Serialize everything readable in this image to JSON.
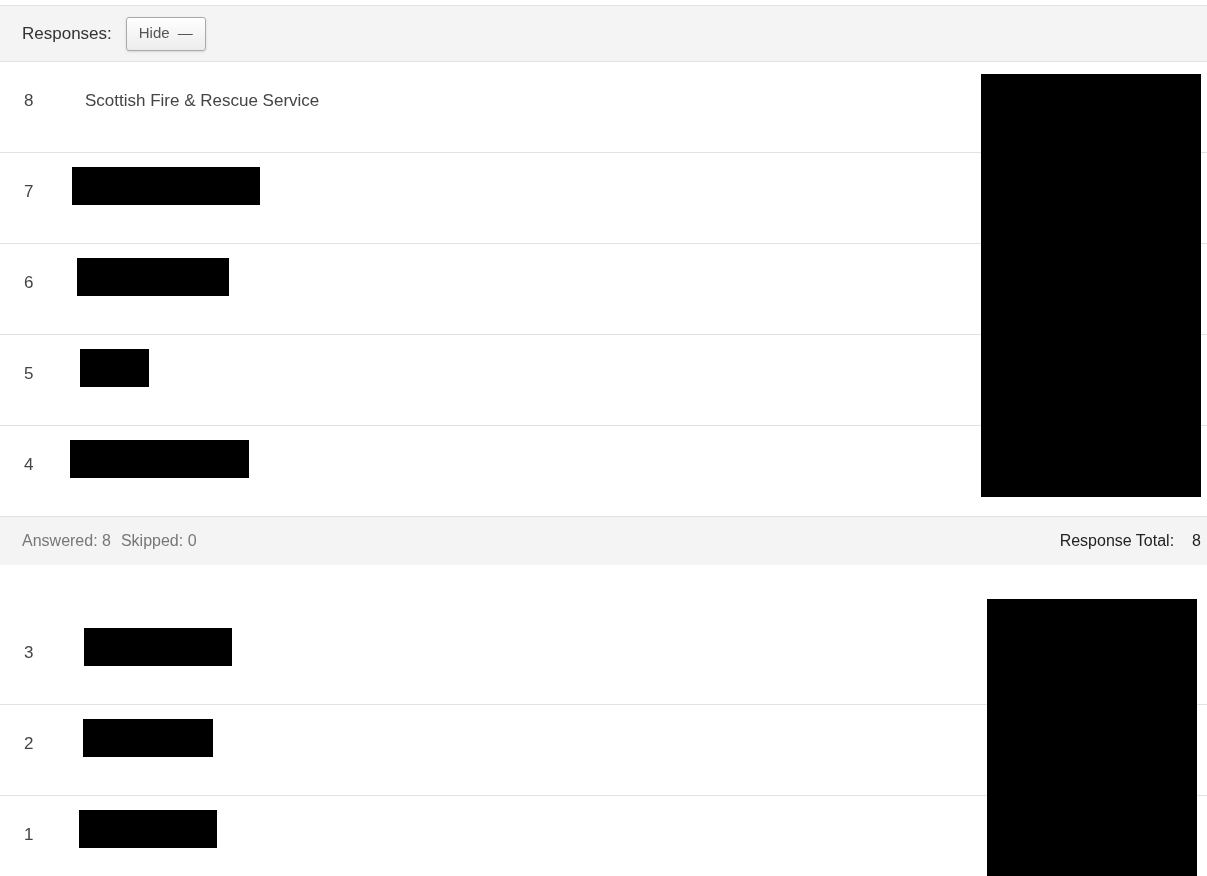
{
  "header": {
    "label": "Responses:",
    "button": "Hide",
    "button_icon": "—"
  },
  "groups": [
    {
      "side_redacted": true,
      "rows": [
        {
          "number": "8",
          "answer": "Scottish Fire & Rescue Service",
          "redacted": false
        },
        {
          "number": "7",
          "redacted": true
        },
        {
          "number": "6",
          "redacted": true
        },
        {
          "number": "5",
          "redacted": true
        },
        {
          "number": "4",
          "redacted": true
        }
      ]
    },
    {
      "side_redacted": true,
      "rows": [
        {
          "number": "3",
          "redacted": true
        },
        {
          "number": "2",
          "redacted": true
        },
        {
          "number": "1",
          "redacted": true
        }
      ]
    }
  ],
  "summary": {
    "answered": "Answered: 8",
    "skipped": "Skipped: 0",
    "total_label": "Response Total:",
    "total": "8"
  }
}
